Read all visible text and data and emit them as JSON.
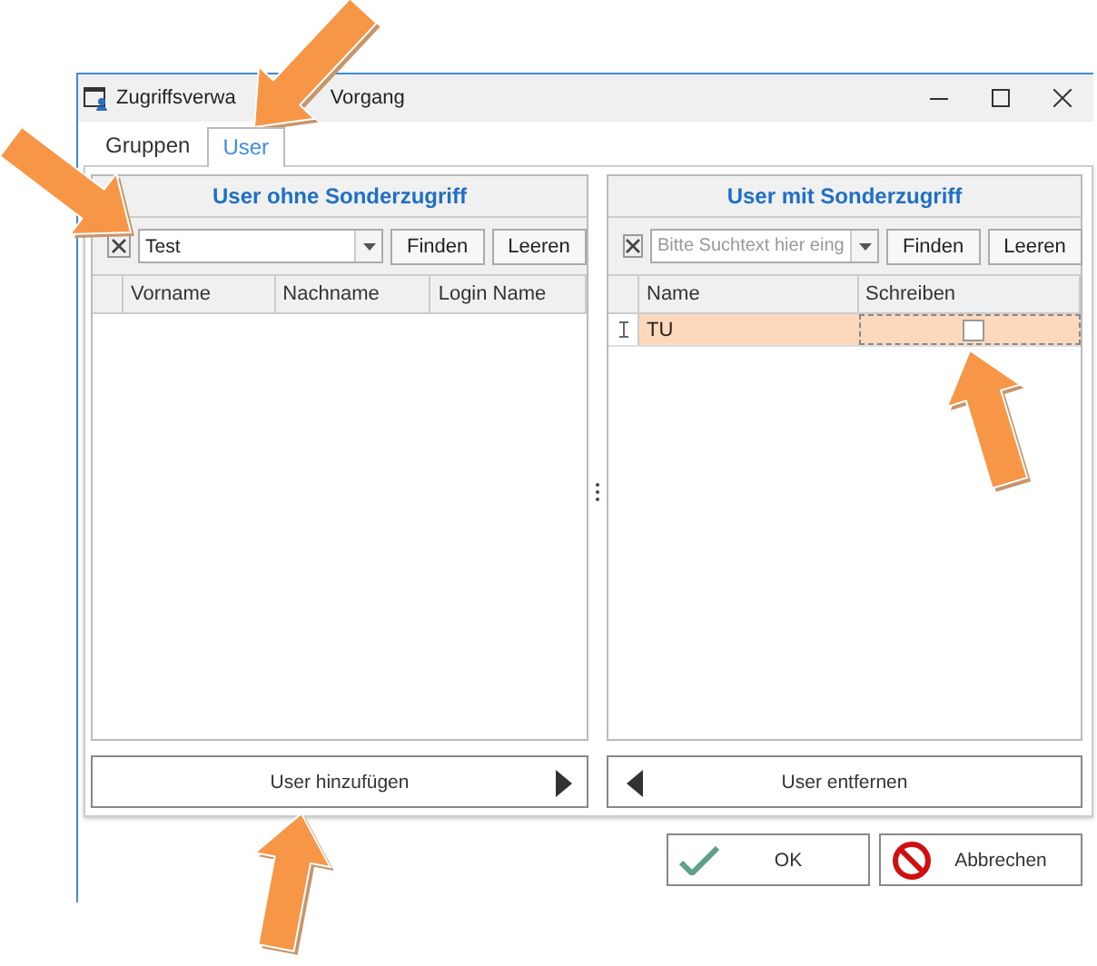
{
  "window": {
    "title_parts": [
      "Zugriffsverwa",
      "Vorgang"
    ]
  },
  "tabs": [
    {
      "label": "Gruppen",
      "selected": false
    },
    {
      "label": "User",
      "selected": true
    }
  ],
  "panels": [
    {
      "title": "User ohne Sonderzugriff",
      "search": {
        "value": "Test"
      },
      "buttons": [
        "Finden",
        "Leeren"
      ],
      "columns": [
        "Vorname",
        "Nachname",
        "Login Name"
      ],
      "action": {
        "label": "User hinzufügen",
        "kind": "add"
      }
    },
    {
      "title": "User mit Sonderzugriff",
      "search": {
        "placeholder": "Bitte Suchtext hier eing"
      },
      "buttons": [
        "Finden",
        "Leeren"
      ],
      "columns": [
        "Name",
        "Schreiben"
      ],
      "rows": [
        {
          "name": "TU",
          "write": false,
          "selected": true
        }
      ],
      "action": {
        "label": "User entfernen",
        "kind": "remove"
      }
    }
  ],
  "footer_buttons": [
    {
      "label": "OK",
      "kind": "ok"
    },
    {
      "label": "Abbrechen",
      "kind": "cancel"
    }
  ]
}
